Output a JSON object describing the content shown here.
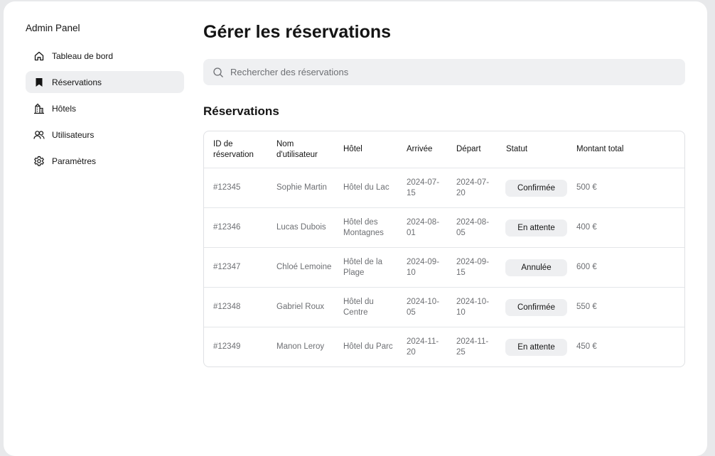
{
  "sidebar": {
    "app_title": "Admin Panel",
    "items": [
      {
        "label": "Tableau de bord",
        "icon": "home-icon",
        "active": false
      },
      {
        "label": "Réservations",
        "icon": "bookmark-icon",
        "active": true
      },
      {
        "label": "Hôtels",
        "icon": "building-icon",
        "active": false
      },
      {
        "label": "Utilisateurs",
        "icon": "users-icon",
        "active": false
      },
      {
        "label": "Paramètres",
        "icon": "gear-icon",
        "active": false
      }
    ]
  },
  "main": {
    "title": "Gérer les réservations",
    "search": {
      "placeholder": "Rechercher des réservations",
      "value": ""
    },
    "section_title": "Réservations",
    "table": {
      "headers": [
        "ID de réservation",
        "Nom d'utilisateur",
        "Hôtel",
        "Arrivée",
        "Départ",
        "Statut",
        "Montant total"
      ],
      "rows": [
        {
          "id": "#12345",
          "user": "Sophie Martin",
          "hotel": "Hôtel du Lac",
          "arrival": "2024-07-15",
          "departure": "2024-07-20",
          "status": "Confirmée",
          "amount": "500 €"
        },
        {
          "id": "#12346",
          "user": "Lucas Dubois",
          "hotel": "Hôtel des Montagnes",
          "arrival": "2024-08-01",
          "departure": "2024-08-05",
          "status": "En attente",
          "amount": "400 €"
        },
        {
          "id": "#12347",
          "user": "Chloé Lemoine",
          "hotel": "Hôtel de la Plage",
          "arrival": "2024-09-10",
          "departure": "2024-09-15",
          "status": "Annulée",
          "amount": "600 €"
        },
        {
          "id": "#12348",
          "user": "Gabriel Roux",
          "hotel": "Hôtel du Centre",
          "arrival": "2024-10-05",
          "departure": "2024-10-10",
          "status": "Confirmée",
          "amount": "550 €"
        },
        {
          "id": "#12349",
          "user": "Manon Leroy",
          "hotel": "Hôtel du Parc",
          "arrival": "2024-11-20",
          "departure": "2024-11-25",
          "status": "En attente",
          "amount": "450 €"
        }
      ]
    }
  },
  "colors": {
    "background": "#e8e9eb",
    "panel": "#ffffff",
    "active_nav": "#eeeff1",
    "muted_text": "#6d6f73",
    "border": "#dfe1e4"
  }
}
